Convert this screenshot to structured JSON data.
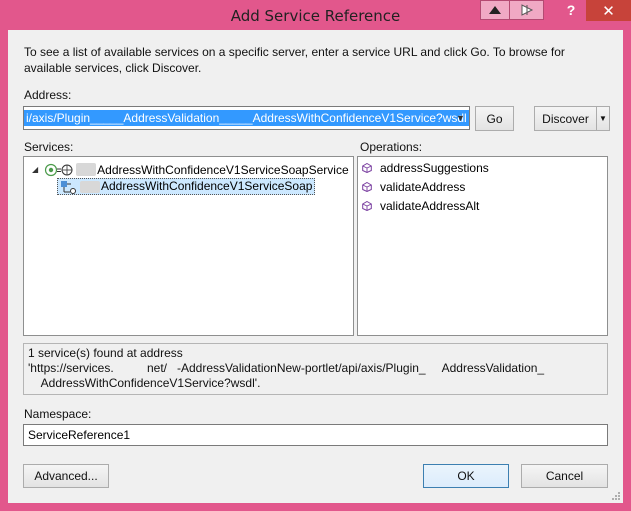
{
  "window": {
    "title": "Add Service Reference",
    "help_glyph": "?",
    "close_glyph": "✕",
    "accent_color": "#e2578c"
  },
  "intro_text": "To see a list of available services on a specific server, enter a service URL and click Go. To browse for available services, click Discover.",
  "address": {
    "label": "Address:",
    "value": "i/axis/Plugin_____AddressValidation_____AddressWithConfidenceV1Service?wsdl"
  },
  "buttons": {
    "go": "Go",
    "discover": "Discover",
    "advanced": "Advanced...",
    "ok": "OK",
    "cancel": "Cancel"
  },
  "services": {
    "label": "Services:",
    "tree": [
      {
        "label": "AddressWithConfidenceV1ServiceSoapService",
        "icon": "service-icon",
        "expanded": true
      },
      {
        "label": "AddressWithConfidenceV1ServiceSoap",
        "icon": "interface-icon",
        "selected": true
      }
    ]
  },
  "operations": {
    "label": "Operations:",
    "items": [
      "addressSuggestions",
      "validateAddress",
      "validateAddressAlt"
    ]
  },
  "status": {
    "line1": "1 service(s) found at address",
    "line2": "'https://services.          net/   -AddressValidationNew-portlet/api/axis/Plugin_     AddressValidation_",
    "line3": "    AddressWithConfidenceV1Service?wsdl'."
  },
  "namespace": {
    "label": "Namespace:",
    "value": "ServiceReference1"
  }
}
